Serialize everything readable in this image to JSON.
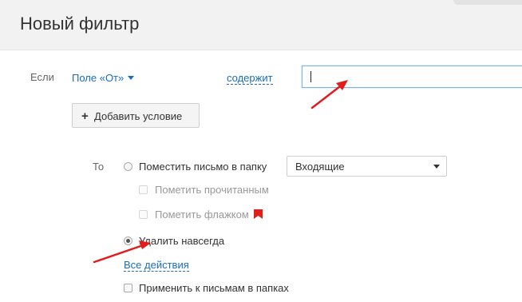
{
  "page_title": "Новый фильтр",
  "condition": {
    "if_label": "Если",
    "field_label": "Поле «От»",
    "operator_label": "содержит",
    "value": ""
  },
  "add_condition_label": "Добавить условие",
  "actions": {
    "then_label": "То",
    "move_to_folder_label": "Поместить письмо в папку",
    "folder_value": "Входящие",
    "mark_read_label": "Пометить прочитанным",
    "mark_flag_label": "Пометить флажком",
    "delete_forever_label": "Удалить навсегда",
    "selected_action": "delete_forever",
    "all_actions_label": "Все действия",
    "apply_to_existing_label": "Применить к письмам в папках"
  },
  "colors": {
    "link": "#1a6dbd",
    "flag": "#e0201b",
    "annotation_arrow": "#e31b1b"
  }
}
